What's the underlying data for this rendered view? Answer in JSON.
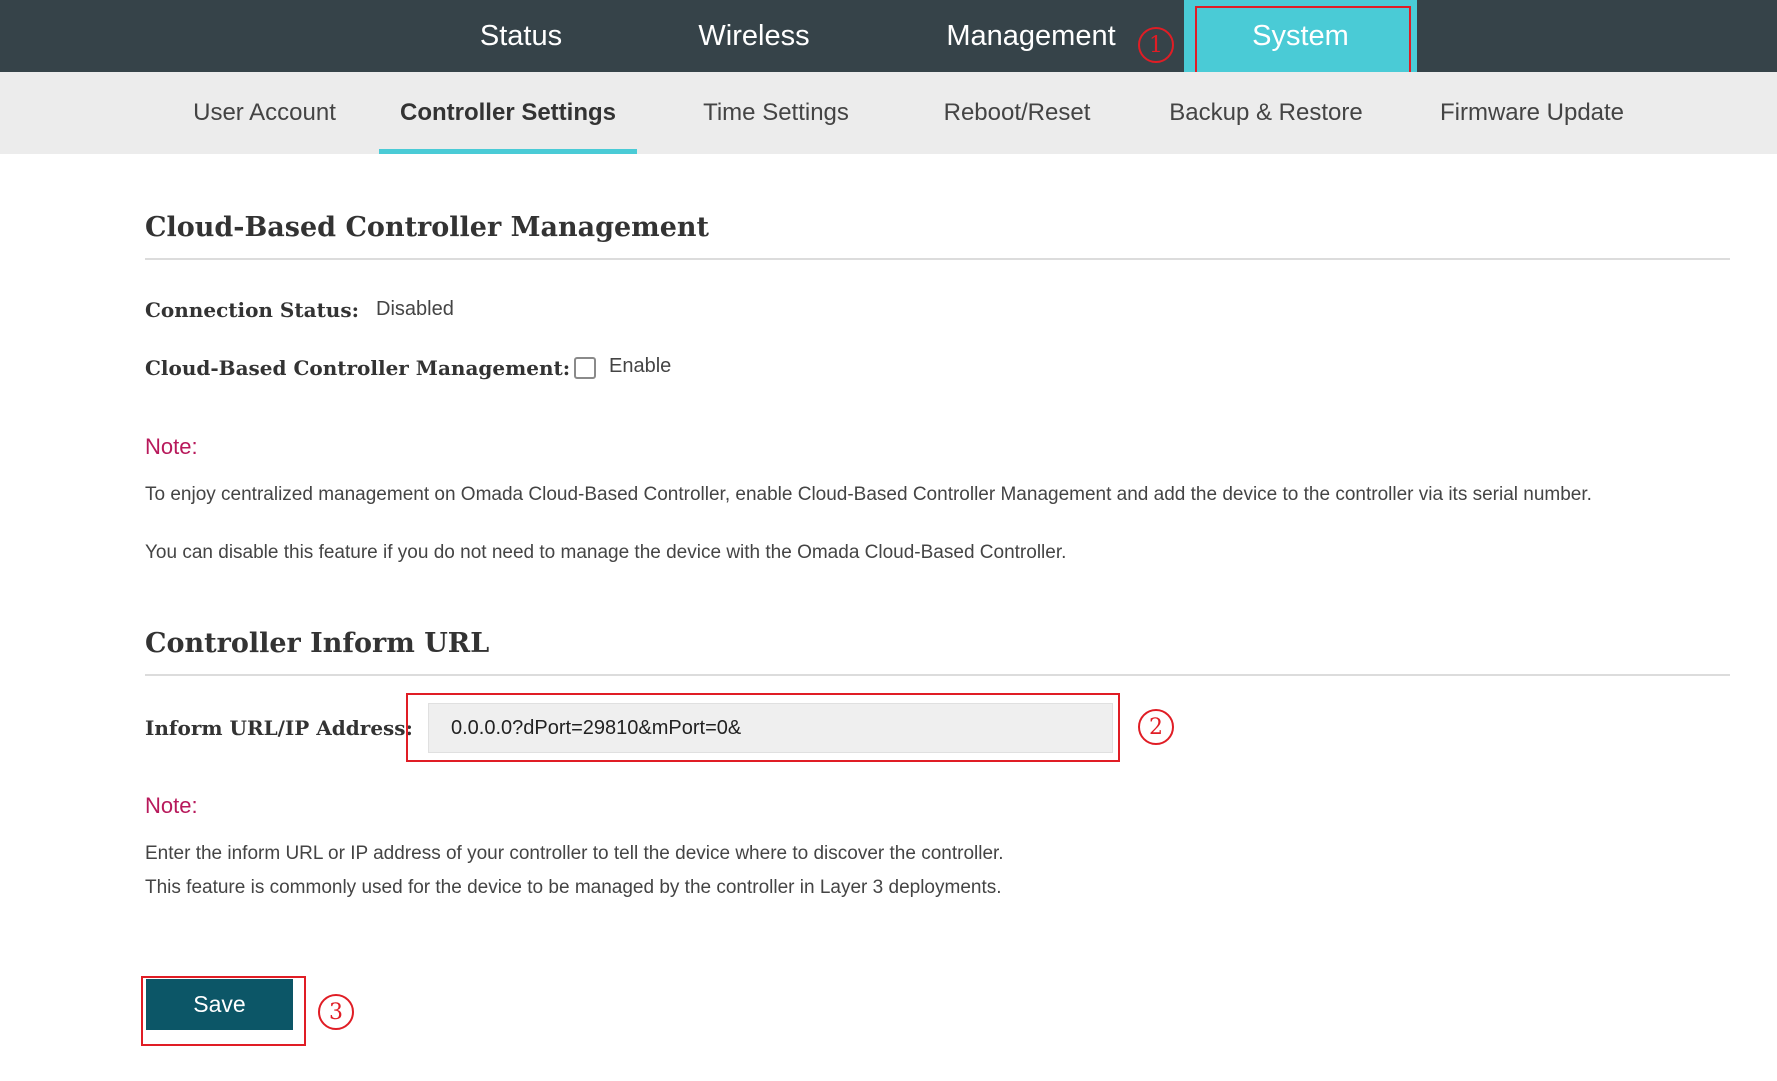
{
  "top_nav": {
    "tabs": [
      "Status",
      "Wireless",
      "Management",
      "System"
    ],
    "active": "System"
  },
  "sub_nav": {
    "tabs": [
      "User Account",
      "Controller Settings",
      "Time Settings",
      "Reboot/Reset",
      "Backup & Restore",
      "Firmware Update"
    ],
    "active": "Controller Settings"
  },
  "cloud_section": {
    "title": "Cloud-Based Controller Management",
    "connection_status_label": "Connection Status:",
    "connection_status_value": "Disabled",
    "cloud_mgmt_label": "Cloud-Based Controller Management:",
    "enable_label": "Enable",
    "enable_checked": false,
    "note_title": "Note:",
    "note_lines": [
      "To enjoy centralized management on Omada Cloud-Based Controller, enable Cloud-Based Controller Management and add the device to the controller via its serial number.",
      "You can disable this feature if you do not need to manage the device with the Omada Cloud-Based Controller."
    ]
  },
  "inform_section": {
    "title": "Controller Inform URL",
    "field_label": "Inform URL/IP Address:",
    "field_value": "0.0.0.0?dPort=29810&mPort=0&",
    "note_title": "Note:",
    "note_lines": [
      "Enter the inform URL or IP address of your controller to tell the device where to discover the controller.",
      "This feature is commonly used for the device to be managed by the controller in Layer 3 deployments."
    ]
  },
  "save_button": {
    "label": "Save"
  },
  "callouts": [
    "1",
    "2",
    "3"
  ],
  "colors": {
    "top_nav_bg": "#364349",
    "accent": "#4acbd6",
    "note_title": "#b8195b",
    "save_button_bg": "#0c5667",
    "callout_red": "#e01d25"
  }
}
